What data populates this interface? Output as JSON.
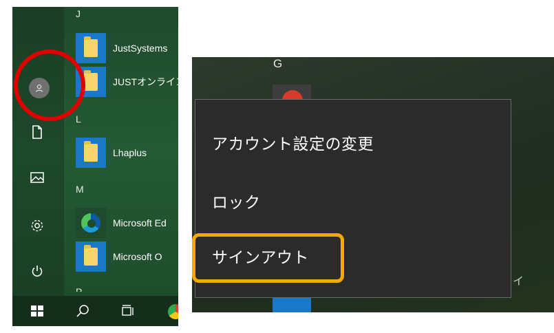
{
  "start_menu": {
    "section_letters": {
      "j": "J",
      "l": "L",
      "m": "M",
      "p": "P"
    },
    "apps": [
      {
        "label": "JustSystems",
        "icon": "folder-icon"
      },
      {
        "label": "JUSTオンライン",
        "icon": "folder-icon"
      },
      {
        "label": "Lhaplus",
        "icon": "folder-icon"
      },
      {
        "label": "Microsoft Ed",
        "icon": "edge-icon"
      },
      {
        "label": "Microsoft O",
        "icon": "folder-icon"
      }
    ],
    "rail_icons": [
      "user-avatar-icon",
      "document-icon",
      "pictures-icon",
      "settings-gear-icon",
      "power-icon"
    ],
    "taskbar_icons": [
      "windows-logo-icon",
      "search-icon",
      "task-view-icon",
      "chrome-icon"
    ]
  },
  "account_menu": {
    "section_letter": "G",
    "items": [
      {
        "label": "アカウント設定の変更"
      },
      {
        "label": "ロック"
      },
      {
        "label": "サインアウト"
      }
    ],
    "edge_fragment": "イ"
  },
  "colors": {
    "start_bg": "#245a34",
    "menu_bg": "#2b2b2b",
    "annotation_red": "#e10000",
    "annotation_orange": "#f5a800",
    "tile_blue": "#1a78c8"
  }
}
